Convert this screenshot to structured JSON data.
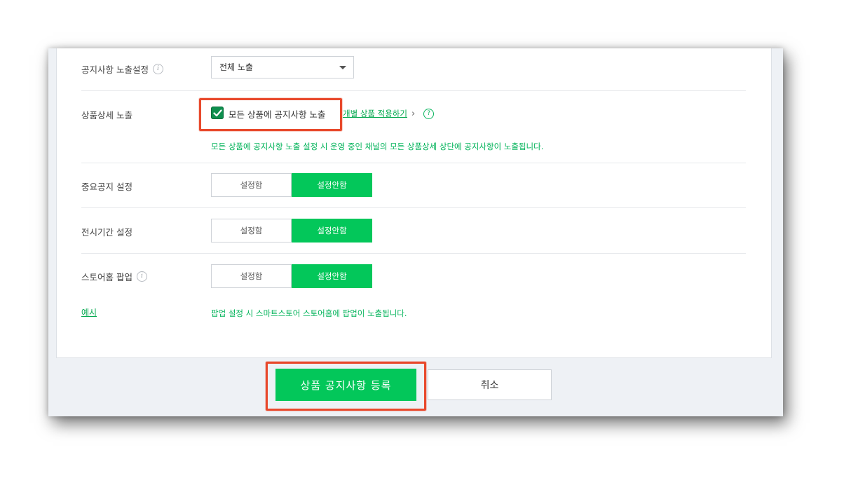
{
  "settings": {
    "notice_exposure": {
      "label": "공지사항 노출설정",
      "info_icon": "i",
      "select_value": "전체 노출"
    },
    "product_detail": {
      "label": "상품상세 노출",
      "checkbox_checked": true,
      "checkbox_label": "모든 상품에 공지사항 노출",
      "link_label": "개별 상품 적용하기",
      "link_chevron": "›",
      "help_icon": "?",
      "note": "모든 상품에 공지사항 노출 설정 시 운영 중인 채널의 모든 상품상세 상단에 공지사항이 노출됩니다."
    },
    "important_notice": {
      "label": "중요공지 설정",
      "option_on": "설정함",
      "option_off": "설정안함",
      "selected": "설정안함"
    },
    "display_period": {
      "label": "전시기간 설정",
      "option_on": "설정함",
      "option_off": "설정안함",
      "selected": "설정안함"
    },
    "store_popup": {
      "label": "스토어홈 팝업",
      "info_icon": "i",
      "option_on": "설정함",
      "option_off": "설정안함",
      "selected": "설정안함",
      "example_link": "예시",
      "note": "팝업 설정 시 스마트스토어 스토어홈에 팝업이 노출됩니다."
    }
  },
  "buttons": {
    "register": "상품 공지사항 등록",
    "cancel": "취소"
  },
  "colors": {
    "accent_green": "#03c75a",
    "highlight_red": "#e8492c"
  }
}
